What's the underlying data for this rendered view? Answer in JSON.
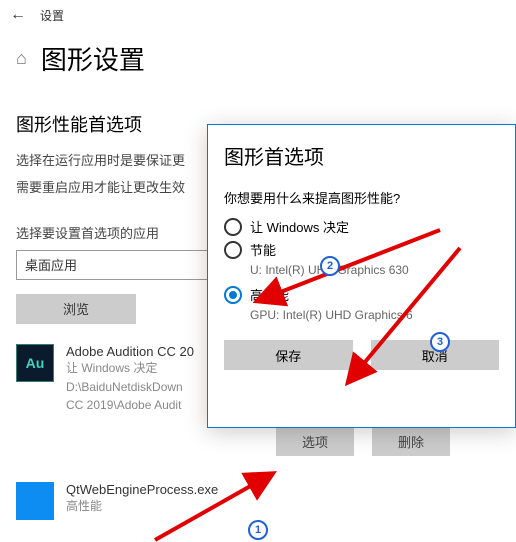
{
  "topbar": {
    "label": "设置"
  },
  "header": {
    "title": "图形设置"
  },
  "section": {
    "title": "图形性能首选项"
  },
  "desc": {
    "line1": "选择在运行应用时是要保证更",
    "line2": "需要重启应用才能让更改生效"
  },
  "selectLabel": "选择要设置首选项的应用",
  "selectValue": "桌面应用",
  "browse": "浏览",
  "apps": [
    {
      "name": "Adobe Audition CC 20",
      "pref": "让 Windows 决定",
      "path1": "D:\\BaiduNetdiskDown",
      "path2": "CC 2019\\Adobe Audit",
      "iconText": "Au",
      "iconClass": "au"
    },
    {
      "name": "QtWebEngineProcess.exe",
      "pref": "高性能",
      "iconText": "",
      "iconClass": "blue"
    }
  ],
  "rowButtons": {
    "options": "选项",
    "delete": "删除"
  },
  "dialog": {
    "title": "图形首选项",
    "question": "你想要用什么来提高图形性能?",
    "opt1": "让 Windows 决定",
    "opt2": "节能",
    "opt2sub": "U: Intel(R) UHD Graphics 630",
    "opt3": "高性能",
    "opt3sub": "GPU: Intel(R) UHD Graphics 6",
    "save": "保存",
    "cancel": "取消"
  },
  "badges": {
    "b1": "1",
    "b2": "2",
    "b3": "3"
  }
}
